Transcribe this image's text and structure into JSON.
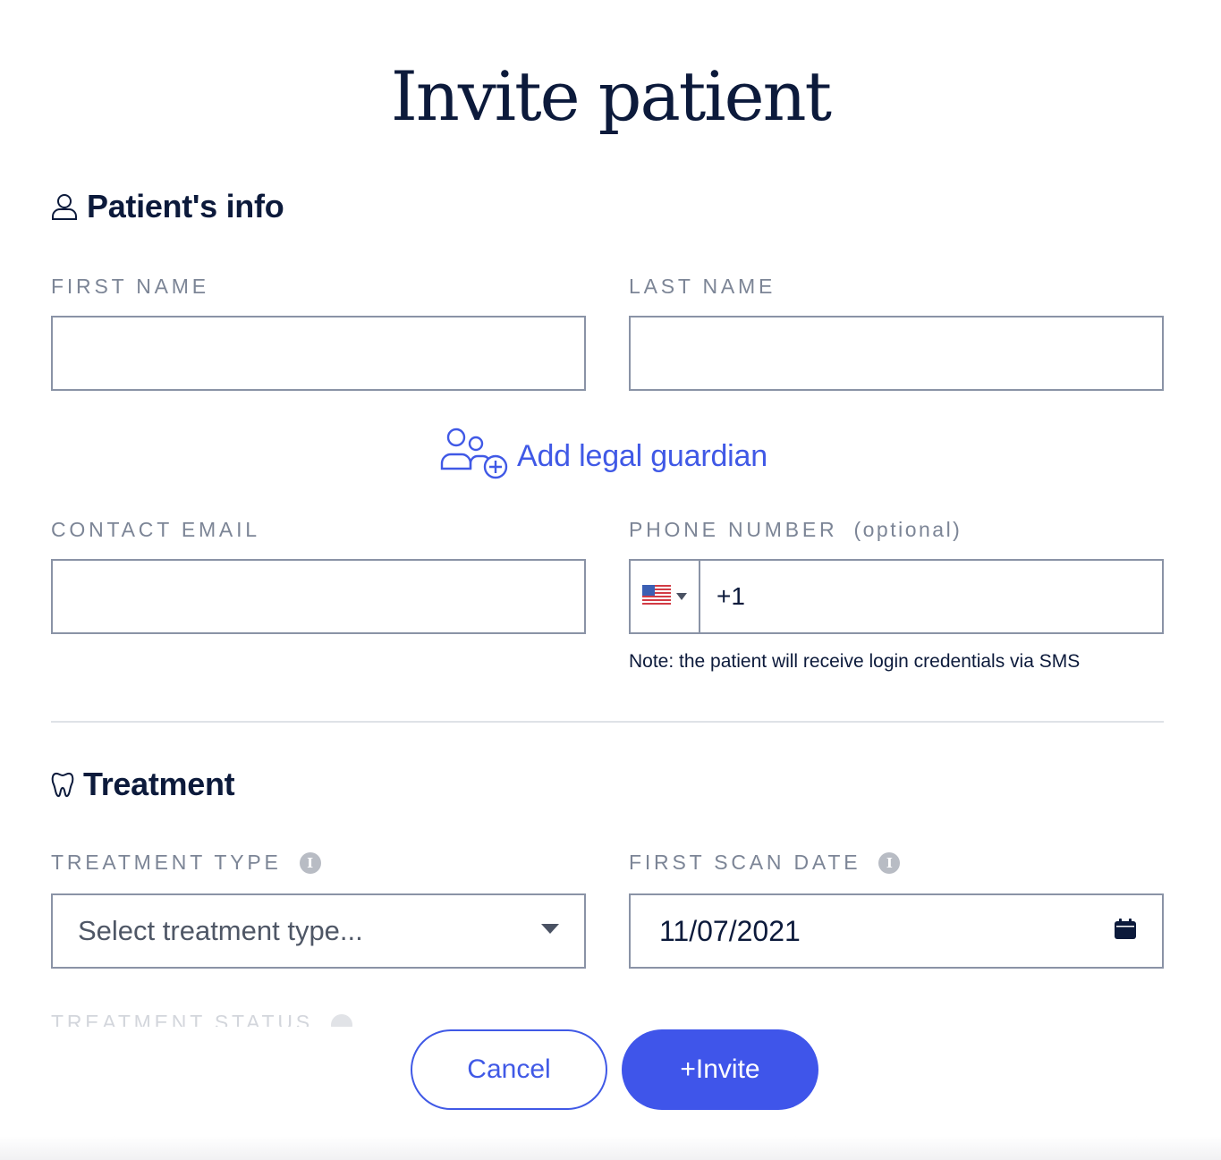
{
  "title": "Invite patient",
  "patient_info": {
    "heading": "Patient's info",
    "first_name": {
      "label": "FIRST NAME",
      "value": ""
    },
    "last_name": {
      "label": "LAST NAME",
      "value": ""
    },
    "add_guardian_label": "Add legal guardian",
    "contact_email": {
      "label": "CONTACT EMAIL",
      "value": ""
    },
    "phone": {
      "label": "PHONE NUMBER",
      "optional": "(optional)",
      "country_flag": "us-flag-icon",
      "dial_code": "+1"
    },
    "note": "Note: the patient will receive login credentials via SMS"
  },
  "treatment": {
    "heading": "Treatment",
    "type": {
      "label": "TREATMENT TYPE",
      "placeholder": "Select treatment type..."
    },
    "first_scan_date": {
      "label": "FIRST SCAN DATE",
      "value": "11/07/2021"
    },
    "status_label": "TREATMENT STATUS"
  },
  "actions": {
    "cancel": "Cancel",
    "invite": "+Invite"
  },
  "colors": {
    "accent": "#3f55ea",
    "text_dark": "#0c1a3b",
    "label_gray": "#7c8596",
    "border": "#8a93a6"
  }
}
